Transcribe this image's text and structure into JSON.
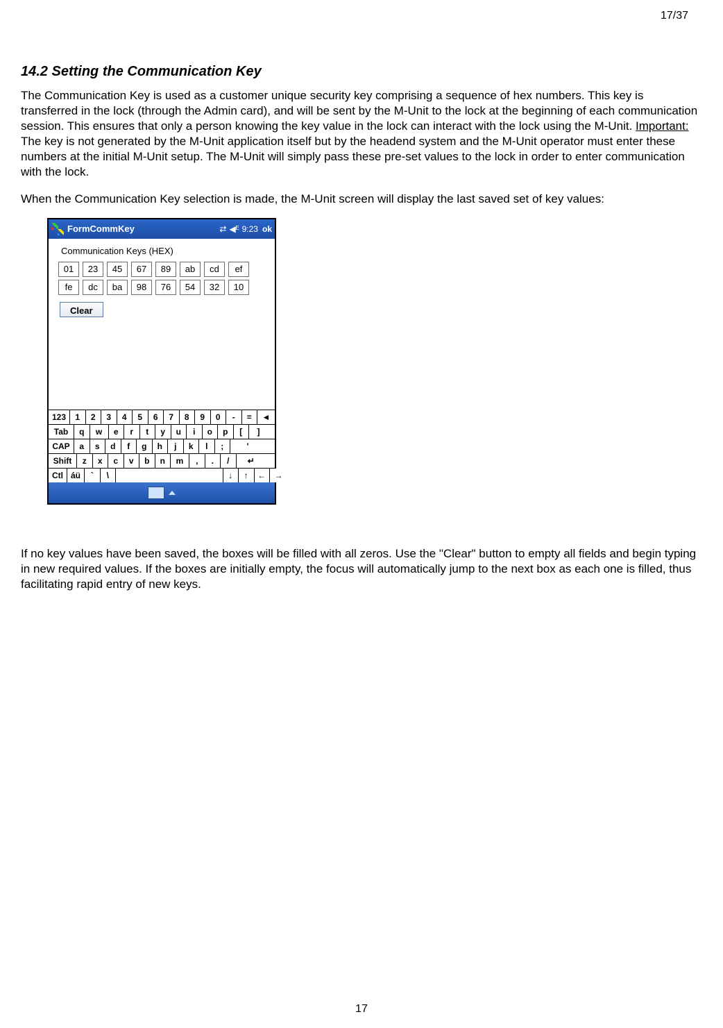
{
  "page": {
    "page_count": "17/37",
    "footer_page": "17"
  },
  "heading": {
    "number": "14.2",
    "title": "14.2  Setting the Communication Key"
  },
  "paragraphs": {
    "p1a": "The Communication Key is used as a customer unique security key comprising a sequence of hex numbers. This key is transferred in the lock (through the Admin card), and will be sent by the M-Unit to the lock at the beginning of each communication session. This ensures that only a person knowing the key value in the lock can interact with the lock using the M-Unit. ",
    "p1_important": "Important:",
    "p1b": "  The key is not generated by the M-Unit application itself but by the headend system and the M-Unit operator must enter these numbers at the initial M-Unit setup. The M-Unit will simply pass these pre-set values to the lock in order to enter communication with the lock.",
    "p2": "When the Communication Key selection is made, the M-Unit screen will display the last saved set of key values:",
    "p3": "If no key values have been saved, the boxes will be filled with all zeros. Use the \"Clear\" button to empty all fields and begin typing in new required values. If the boxes are initially empty, the focus will automatically jump to the next box as each one is filled, thus facilitating rapid entry of new keys."
  },
  "munit": {
    "title": "FormCommKey",
    "time": "9:23",
    "ok": "ok",
    "body_label": "Communication Keys (HEX)",
    "hex_row1": [
      "01",
      "23",
      "45",
      "67",
      "89",
      "ab",
      "cd",
      "ef"
    ],
    "hex_row2": [
      "fe",
      "dc",
      "ba",
      "98",
      "76",
      "54",
      "32",
      "10"
    ],
    "clear_label": "Clear",
    "kb": {
      "r1": [
        "123",
        "1",
        "2",
        "3",
        "4",
        "5",
        "6",
        "7",
        "8",
        "9",
        "0",
        "-",
        "=",
        "◄"
      ],
      "r2": [
        "Tab",
        "q",
        "w",
        "e",
        "r",
        "t",
        "y",
        "u",
        "i",
        "o",
        "p",
        "[",
        "]"
      ],
      "r3": [
        "CAP",
        "a",
        "s",
        "d",
        "f",
        "g",
        "h",
        "j",
        "k",
        "l",
        ";",
        "'"
      ],
      "r4": [
        "Shift",
        "z",
        "x",
        "c",
        "v",
        "b",
        "n",
        "m",
        ",",
        ".",
        "/",
        "↵"
      ],
      "r5": [
        "Ctl",
        "áü",
        "`",
        "\\",
        "",
        "↓",
        "↑",
        "←",
        "→"
      ]
    }
  }
}
